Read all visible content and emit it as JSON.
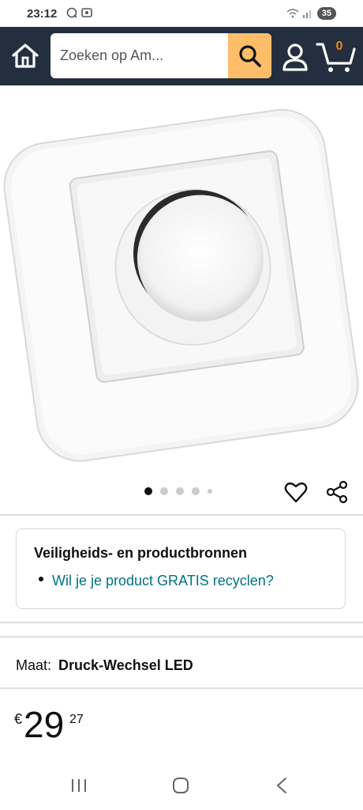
{
  "status_bar": {
    "time": "23:12",
    "battery": "35"
  },
  "header": {
    "search_placeholder": "Zoeken op Am...",
    "cart_count": "0"
  },
  "icons": {
    "home": "home-icon",
    "search": "search-icon",
    "account": "user-icon",
    "cart": "cart-icon",
    "wishlist": "heart-icon",
    "share": "share-icon"
  },
  "gallery": {
    "image_count": 5,
    "active_index": 0
  },
  "safety": {
    "title": "Veiligheids- en productbronnen",
    "link": "Wil je je product GRATIS recyclen?"
  },
  "size": {
    "label": "Maat:",
    "value": "Druck-Wechsel LED"
  },
  "price": {
    "currency": "€",
    "whole": "29",
    "fraction": "27"
  },
  "colors": {
    "header_bg": "#232f3e",
    "search_button": "#febd69",
    "link": "#007185",
    "cart_count": "#f08804"
  }
}
